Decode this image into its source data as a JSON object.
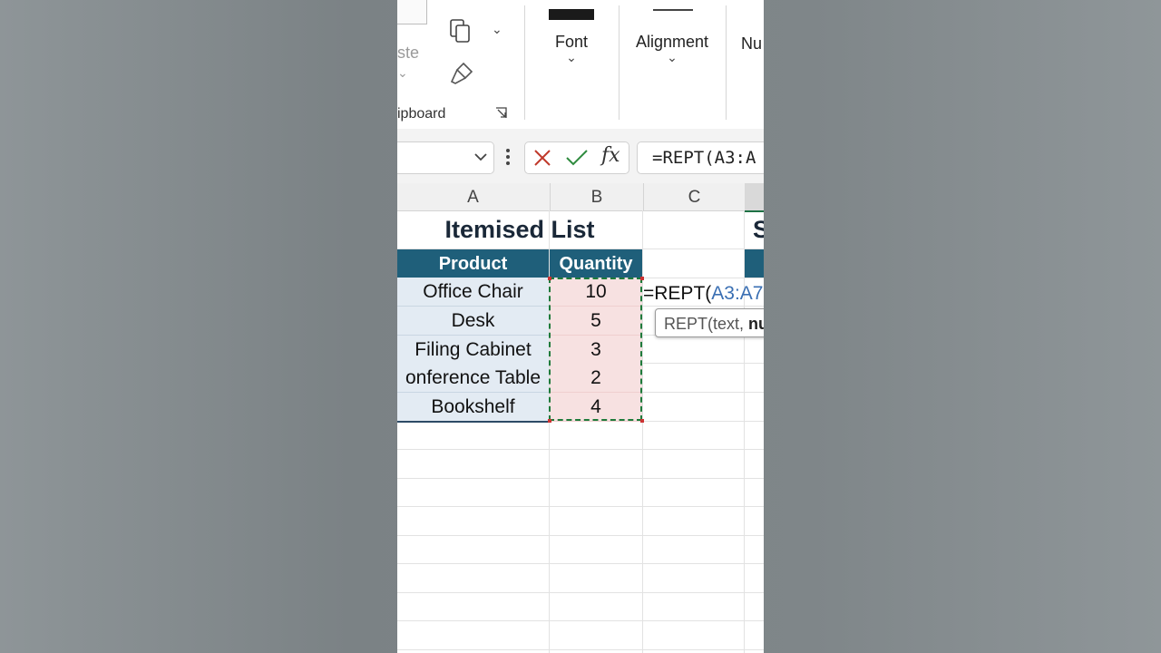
{
  "ribbon": {
    "clipboard_paste_label": "ste",
    "clipboard_group_label": "ipboard",
    "font_label": "Font",
    "alignment_label": "Alignment",
    "number_label": "Nu"
  },
  "formula_bar": {
    "formula_text": "=REPT(A3:A"
  },
  "sheet": {
    "columns": [
      "A",
      "B",
      "C"
    ],
    "title": "Itemised List",
    "next_title": "S",
    "headers": {
      "product": "Product",
      "quantity": "Quantity"
    },
    "rows": [
      {
        "product": "Office Chair",
        "quantity": "10"
      },
      {
        "product": "Desk",
        "quantity": "5"
      },
      {
        "product": "Filing Cabinet",
        "quantity": "3"
      },
      {
        "product": "onference Table",
        "quantity": "2"
      },
      {
        "product": "Bookshelf",
        "quantity": "4"
      }
    ],
    "edit_cell": {
      "prefix": "=REPT(",
      "ref": "A3:A7",
      "suffix": "&"
    },
    "tooltip": {
      "func": "REPT(text, ",
      "arg": "nu"
    }
  },
  "colors": {
    "header_fill": "#1f5f7a",
    "product_fill": "#e3ebf3",
    "quantity_fill": "#f7e1e1",
    "marquee": "#1e7a3a",
    "ref_blue": "#3a6fb3"
  }
}
